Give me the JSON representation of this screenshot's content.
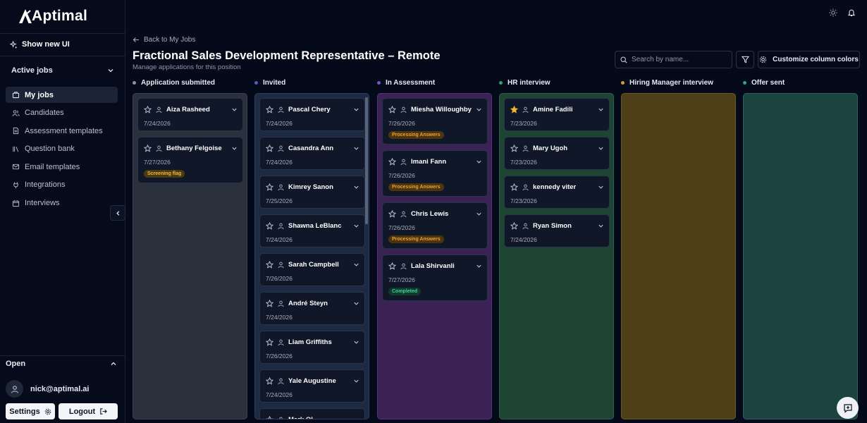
{
  "app": {
    "name": "Aptimal"
  },
  "sidebar": {
    "show_new_ui": "Show new UI",
    "active_jobs": "Active jobs",
    "items": [
      {
        "label": "My jobs",
        "icon": "briefcase-icon",
        "active": true
      },
      {
        "label": "Candidates",
        "icon": "users-icon",
        "active": false
      },
      {
        "label": "Assessment templates",
        "icon": "document-icon",
        "active": false
      },
      {
        "label": "Question bank",
        "icon": "library-icon",
        "active": false
      },
      {
        "label": "Email templates",
        "icon": "mail-icon",
        "active": false
      },
      {
        "label": "Integrations",
        "icon": "plug-icon",
        "active": false
      },
      {
        "label": "Interviews",
        "icon": "calendar-icon",
        "active": false
      }
    ],
    "open_label": "Open",
    "user_email": "nick@aptimal.ai",
    "settings_label": "Settings",
    "logout_label": "Logout"
  },
  "header": {
    "back_label": "Back to My Jobs",
    "title": "Fractional Sales Development Representative – Remote",
    "subtitle": "Manage applications for this position",
    "search_placeholder": "Search by name...",
    "customize_label": "Customize column colors"
  },
  "columns": [
    {
      "title": "Application submitted",
      "dot": "#8a92a6",
      "bg": "#2b313c",
      "border": "#3a4150",
      "cards": [
        {
          "name": "Aiza Rasheed",
          "date": "7/24/2026",
          "starred": false
        },
        {
          "name": "Bethany Felgoise",
          "date": "7/27/2026",
          "starred": false,
          "badge": "Screening flag",
          "badge_type": "flag"
        }
      ]
    },
    {
      "title": "Invited",
      "dot": "#4f5fb0",
      "bg": "#1d2a44",
      "border": "#2c3d60",
      "cards": [
        {
          "name": "Pascal Chery",
          "date": "7/24/2026",
          "starred": false
        },
        {
          "name": "Casandra Ann",
          "date": "7/24/2026",
          "starred": false
        },
        {
          "name": "Kimrey Sanon",
          "date": "7/25/2026",
          "starred": false
        },
        {
          "name": "Shawna LeBlanc",
          "date": "7/24/2026",
          "starred": false
        },
        {
          "name": "Sarah Campbell",
          "date": "7/26/2026",
          "starred": false
        },
        {
          "name": "André Steyn",
          "date": "7/24/2026",
          "starred": false
        },
        {
          "name": "Liam Griffiths",
          "date": "7/26/2026",
          "starred": false
        },
        {
          "name": "Yale Augustine",
          "date": "7/24/2026",
          "starred": false
        },
        {
          "name": "Mark Ol",
          "date": "",
          "starred": false
        }
      ]
    },
    {
      "title": "In Assessment",
      "dot": "#7b4fc8",
      "bg": "#3a2354",
      "border": "#53337a",
      "cards": [
        {
          "name": "Miesha Willoughby",
          "date": "7/26/2026",
          "starred": false,
          "badge": "Processing Answers",
          "badge_type": "processing"
        },
        {
          "name": "Imani Fann",
          "date": "7/26/2026",
          "starred": false,
          "badge": "Processing Answers",
          "badge_type": "processing"
        },
        {
          "name": "Chris Lewis",
          "date": "7/26/2026",
          "starred": false,
          "badge": "Processing Answers",
          "badge_type": "processing"
        },
        {
          "name": "Lala Shirvanli",
          "date": "7/27/2026",
          "starred": false,
          "badge": "Completed",
          "badge_type": "completed"
        }
      ]
    },
    {
      "title": "HR interview",
      "dot": "#2fa36e",
      "bg": "#1e4434",
      "border": "#2d6049",
      "cards": [
        {
          "name": "Amine Fadili",
          "date": "7/23/2026",
          "starred": true
        },
        {
          "name": "Mary Ugoh",
          "date": "7/23/2026",
          "starred": false
        },
        {
          "name": "kennedy viter",
          "date": "7/23/2026",
          "starred": false
        },
        {
          "name": "Ryan Simon",
          "date": "7/24/2026",
          "starred": false
        }
      ]
    },
    {
      "title": "Hiring Manager interview",
      "dot": "#d09a36",
      "bg": "#4f3f18",
      "border": "#6b5624",
      "cards": []
    },
    {
      "title": "Offer sent",
      "dot": "#2fa392",
      "bg": "#1b4440",
      "border": "#2a625b",
      "cards": []
    }
  ],
  "colors": {
    "accent_star": "#f5b82e",
    "background": "#050a1a",
    "card": "#0f1728"
  }
}
